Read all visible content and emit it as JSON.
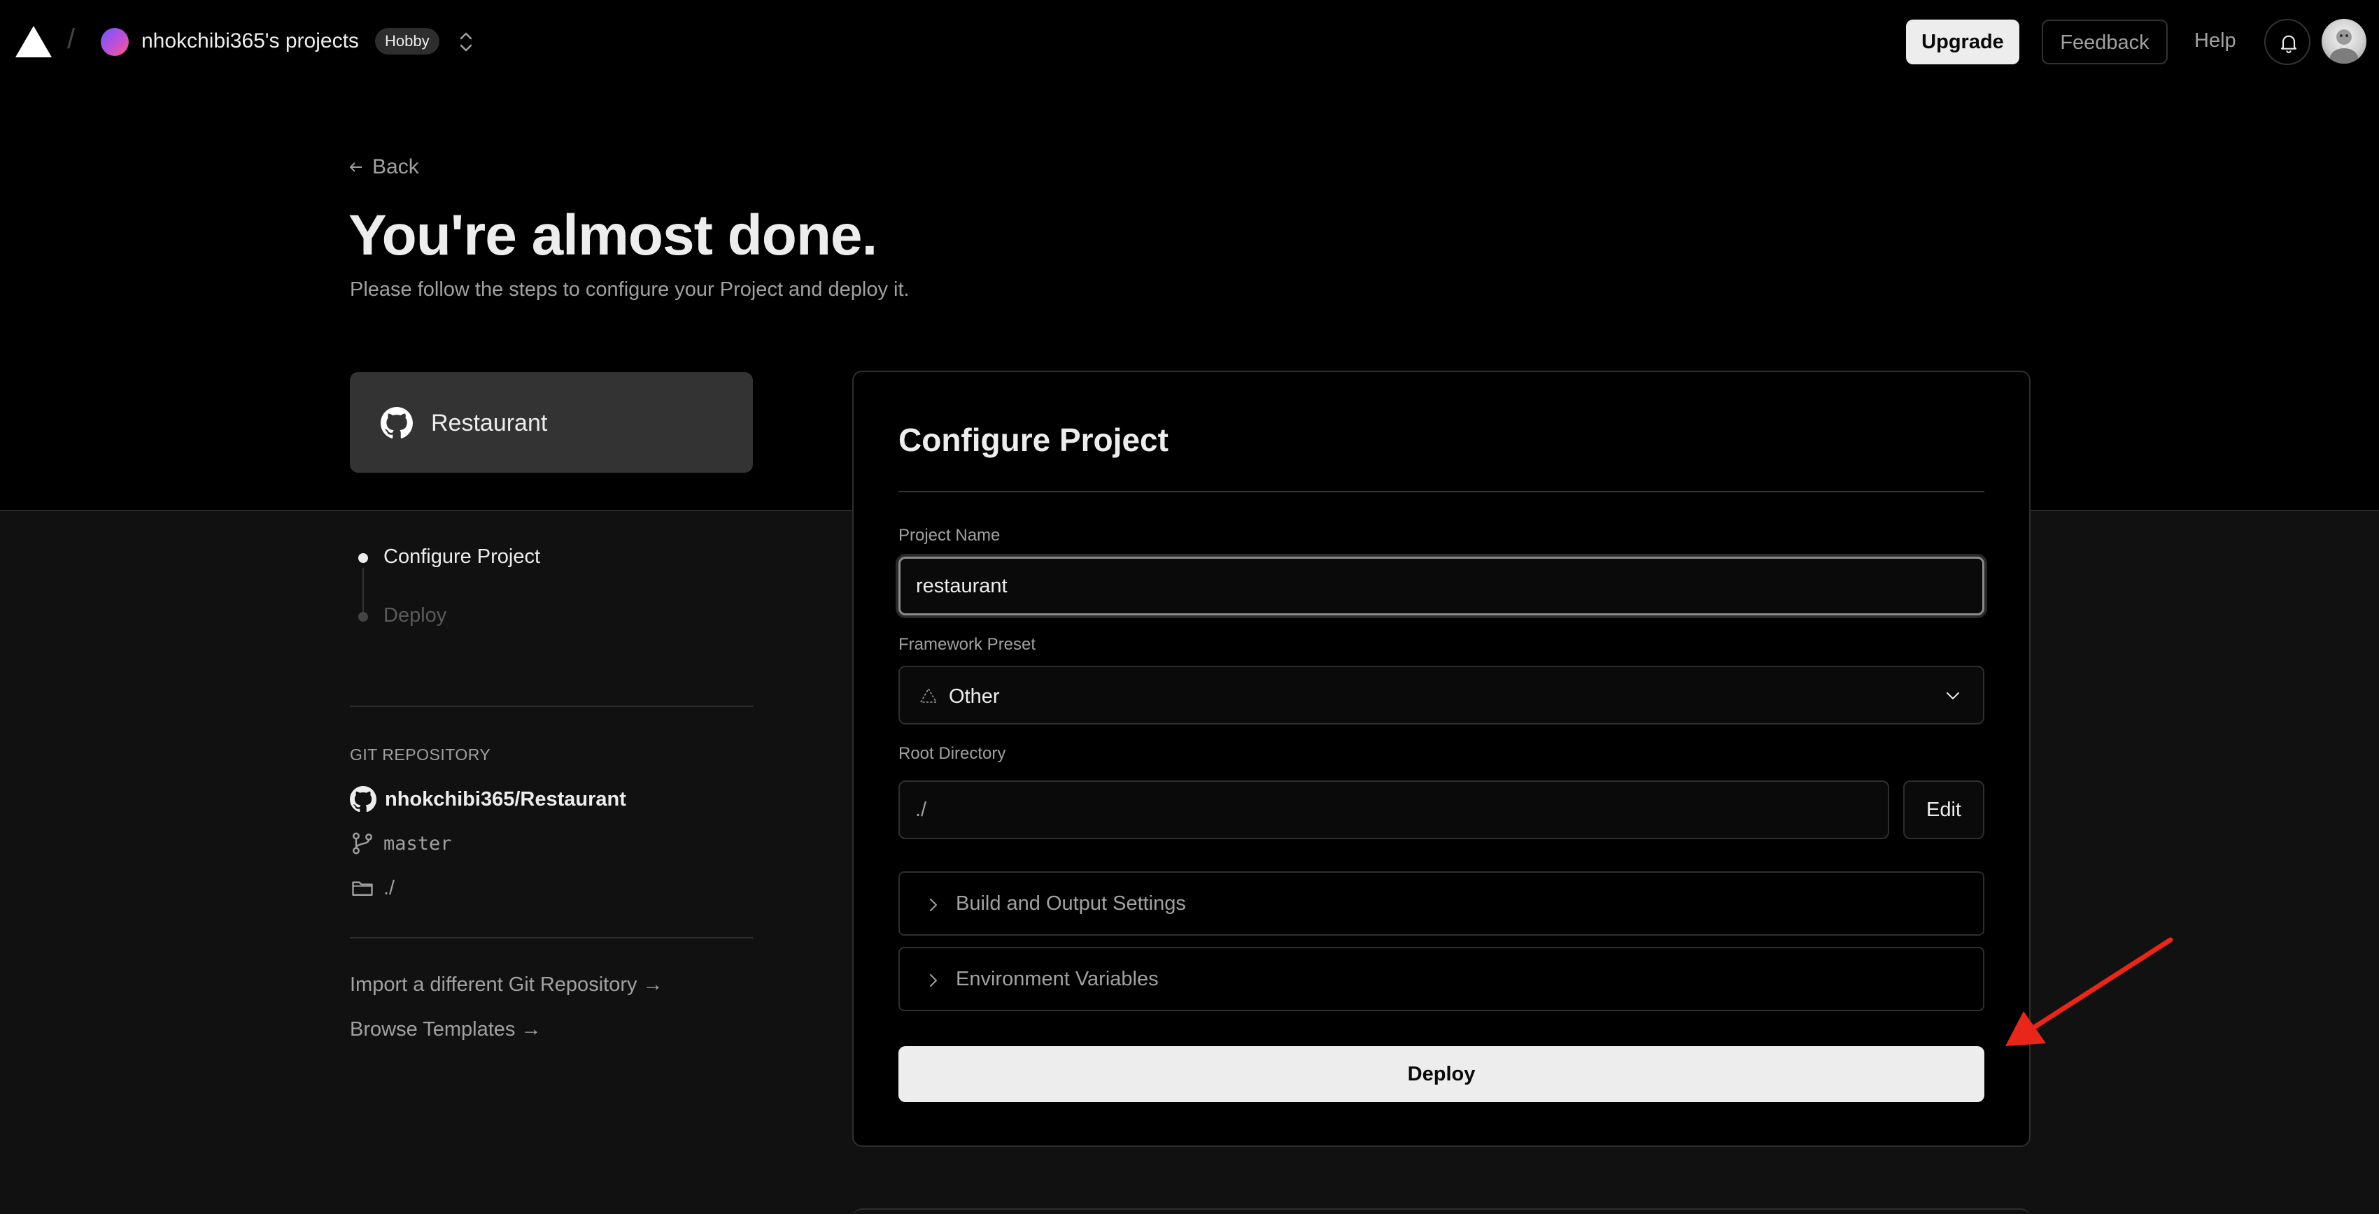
{
  "topnav": {
    "team_name": "nhokchibi365's projects",
    "plan_badge": "Hobby",
    "upgrade_label": "Upgrade",
    "feedback_label": "Feedback",
    "help_label": "Help",
    "icons": [
      "vercel-logo-icon",
      "team-switcher-icon",
      "bell-icon",
      "user-avatar"
    ]
  },
  "header": {
    "back_label": "Back",
    "title": "You're almost done.",
    "subtitle": "Please follow the steps to configure your Project and deploy it."
  },
  "repo_card": {
    "name": "Restaurant"
  },
  "steps": [
    {
      "label": "Configure Project",
      "state": "active"
    },
    {
      "label": "Deploy",
      "state": "inactive"
    }
  ],
  "git": {
    "heading": "GIT REPOSITORY",
    "repo": "nhokchibi365/Restaurant",
    "branch": "master",
    "directory": "./"
  },
  "links": {
    "import_different": "Import a different Git Repository →",
    "browse_templates": "Browse Templates →"
  },
  "config": {
    "title": "Configure Project",
    "project_name_label": "Project Name",
    "project_name_value": "restaurant",
    "framework_label": "Framework Preset",
    "framework_value": "Other",
    "root_label": "Root Directory",
    "root_value": "./",
    "edit_label": "Edit",
    "build_settings_label": "Build and Output Settings",
    "env_vars_label": "Environment Variables",
    "deploy_label": "Deploy"
  },
  "colors": {
    "background": "#111111",
    "hero": "#000000",
    "primary_button": "#ededed",
    "annotation_arrow": "#e8261a"
  }
}
